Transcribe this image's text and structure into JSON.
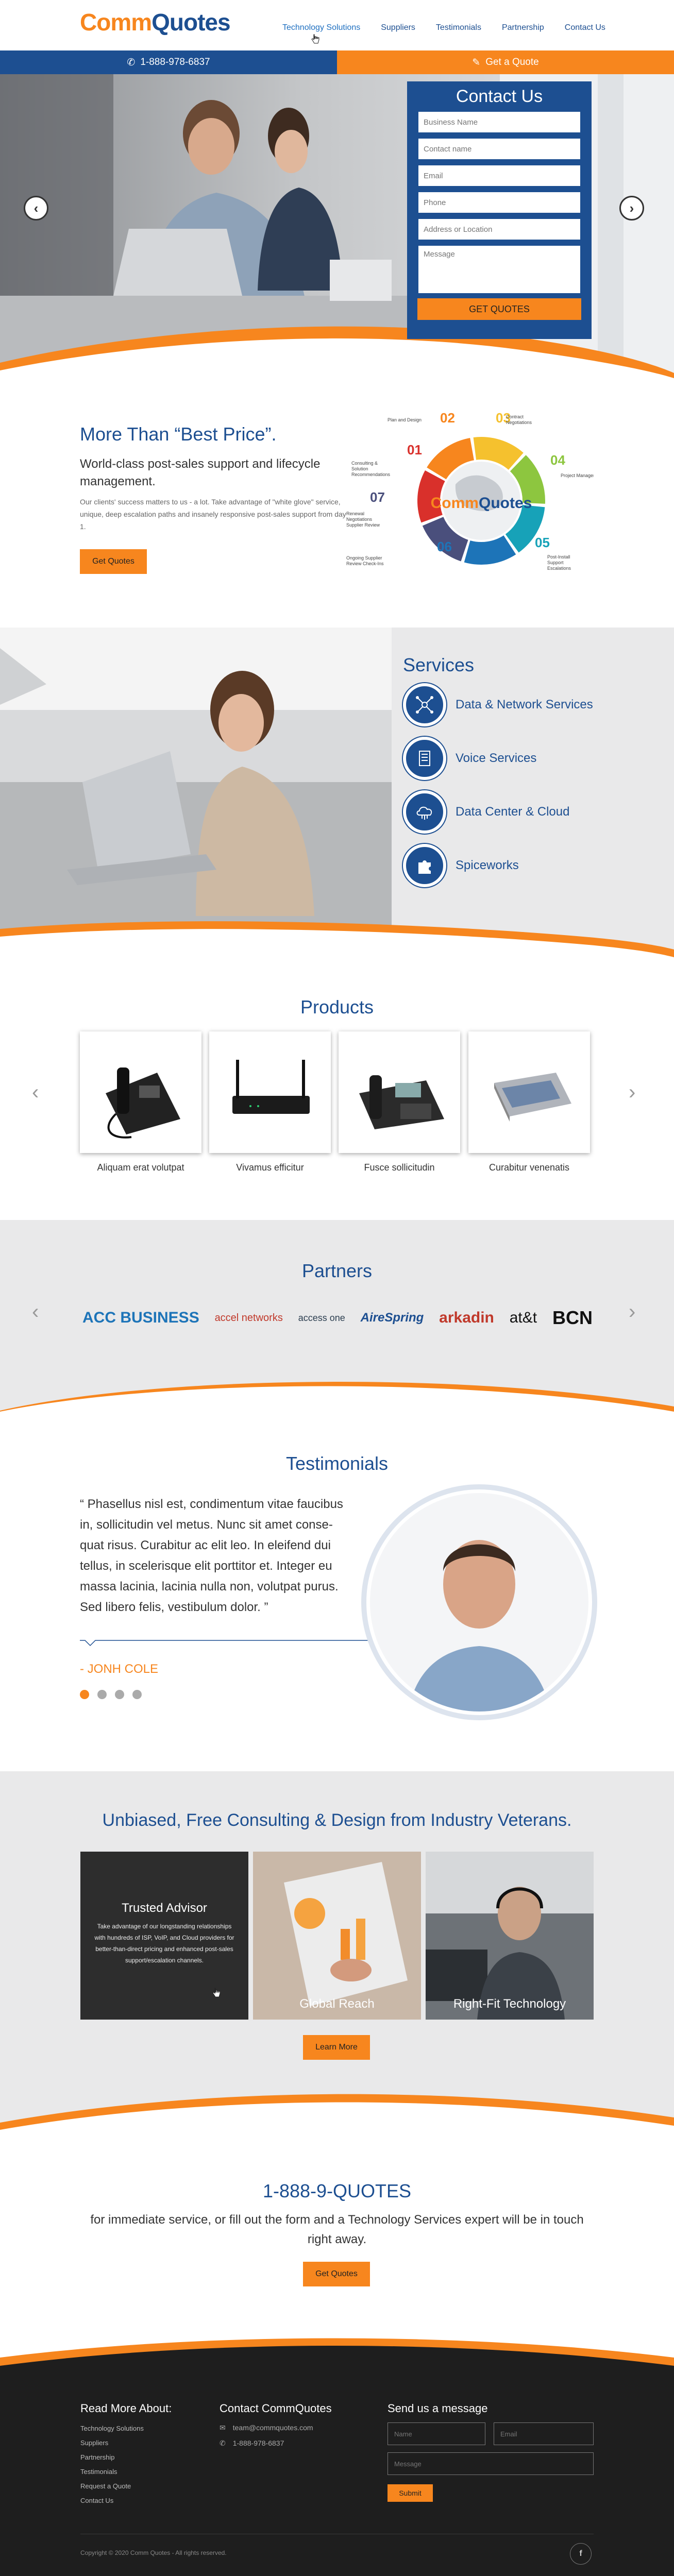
{
  "header": {
    "logo_part1": "Comm",
    "logo_part2": "Quotes",
    "nav": [
      {
        "label": "Technology Solutions"
      },
      {
        "label": "Suppliers"
      },
      {
        "label": "Testimonials"
      },
      {
        "label": "Partnership"
      },
      {
        "label": "Contact Us"
      }
    ]
  },
  "contact_bar": {
    "phone": "1-888-978-6837",
    "quote_label": "Get a Quote"
  },
  "contact_form": {
    "title": "Contact Us",
    "fields": [
      {
        "placeholder": "Business Name"
      },
      {
        "placeholder": "Contact name"
      },
      {
        "placeholder": "Email"
      },
      {
        "placeholder": "Phone"
      },
      {
        "placeholder": "Address or Location"
      }
    ],
    "message_placeholder": "Message",
    "submit_label": "GET QUOTES"
  },
  "best_price": {
    "title": "More Than “Best Price”.",
    "subtitle": "World-class post-sales support and lifecycle management.",
    "text": "Our clients' success matters to us - a lot. Take advantage of \"white glove\" service, unique, deep escalation paths and insanely responsive post-sales support from day 1.",
    "button": "Get Quotes",
    "diagram": {
      "center_part1": "Comm",
      "center_part2": "Quotes",
      "steps": [
        {
          "num": "01",
          "label": "Consulting & Solution Recommendations",
          "color": "#d9302b"
        },
        {
          "num": "02",
          "label": "Plan and Design",
          "color": "#f7861e"
        },
        {
          "num": "03",
          "label": "Contract Negotiations",
          "color": "#f5c12e"
        },
        {
          "num": "04",
          "label": "Project Management",
          "color": "#8dc63f"
        },
        {
          "num": "05",
          "label": "Post-Install Support Escalations",
          "color": "#17a2b8"
        },
        {
          "num": "06",
          "label": "Ongoing Supplier Review Check-Ins",
          "color": "#1d74b8"
        },
        {
          "num": "07",
          "label": "Renewal Negotiations Supplier Review",
          "color": "#4a4f7c"
        }
      ]
    }
  },
  "services": {
    "title": "Services",
    "items": [
      {
        "label": "Data & Network Services",
        "icon": "network-icon"
      },
      {
        "label": "Voice Services",
        "icon": "phone-building-icon"
      },
      {
        "label": "Data Center & Cloud",
        "icon": "cloud-icon"
      },
      {
        "label": "Spiceworks",
        "icon": "puzzle-icon"
      }
    ]
  },
  "products": {
    "title": "Products",
    "items": [
      {
        "label": "Aliquam erat volutpat"
      },
      {
        "label": "Vivamus efficitur"
      },
      {
        "label": "Fusce sollicitudin"
      },
      {
        "label": "Curabitur venenatis"
      }
    ]
  },
  "partners": {
    "title": "Partners",
    "logos": [
      {
        "name": "ACC BUSINESS",
        "color": "#1d74b8"
      },
      {
        "name": "accel networks",
        "color": "#c0392b"
      },
      {
        "name": "access one",
        "color": "#2c3e50"
      },
      {
        "name": "AireSpring",
        "color": "#1d4f91"
      },
      {
        "name": "arkadin",
        "color": "#c0392b"
      },
      {
        "name": "at&t",
        "color": "#111111"
      },
      {
        "name": "BCN",
        "color": "#111111"
      }
    ]
  },
  "testimonials": {
    "title": "Testimonials",
    "quote": "“ Phasellus nisl est, condimentum vitae faucibus in, sollicitudin vel metus. Nunc sit amet conse-quat risus. Curabitur ac elit leo. In eleifend dui tellus, in scelerisque elit porttitor et. Integer eu massa lacinia, lacinia nulla non, volutpat purus. Sed libero felis, vestibulum dolor. ”",
    "name": "- JONH COLE"
  },
  "consulting": {
    "title": "Unbiased, Free Consulting & Design from Industry Veterans.",
    "cards": [
      {
        "title": "Trusted Advisor",
        "text": "Take advantage of our longstanding relationships with hundreds of ISP, VoIP, and Cloud providers for better-than-direct pricing and enhanced post-sales support/escalation channels."
      },
      {
        "title": "Global Reach"
      },
      {
        "title": "Right-Fit Technology"
      }
    ],
    "button": "Learn More"
  },
  "cta": {
    "phone": "1-888-9-QUOTES",
    "text": "for immediate service, or fill out the form and a Technology Services expert will be in touch right away.",
    "button": "Get Quotes"
  },
  "footer": {
    "col1_title": "Read More About:",
    "links": [
      "Technology Solutions",
      "Suppliers",
      "Partnership",
      "Testimonials",
      "Request a Quote",
      "Contact Us"
    ],
    "col2_title": "Contact CommQuotes",
    "email": "team@commquotes.com",
    "phone": "1-888-978-6837",
    "col3_title": "Send us a message",
    "name_placeholder": "Name",
    "email_placeholder": "Email",
    "message_placeholder": "Message",
    "submit": "Submit",
    "copyright": "Copyright © 2020 Comm Quotes - All rights reserved.",
    "social_icon": "facebook-icon"
  },
  "colors": {
    "brand_blue": "#1d4f91",
    "brand_orange": "#f7861e",
    "light_gray": "#e9e9ea",
    "footer_bg": "#1e1e1e"
  }
}
